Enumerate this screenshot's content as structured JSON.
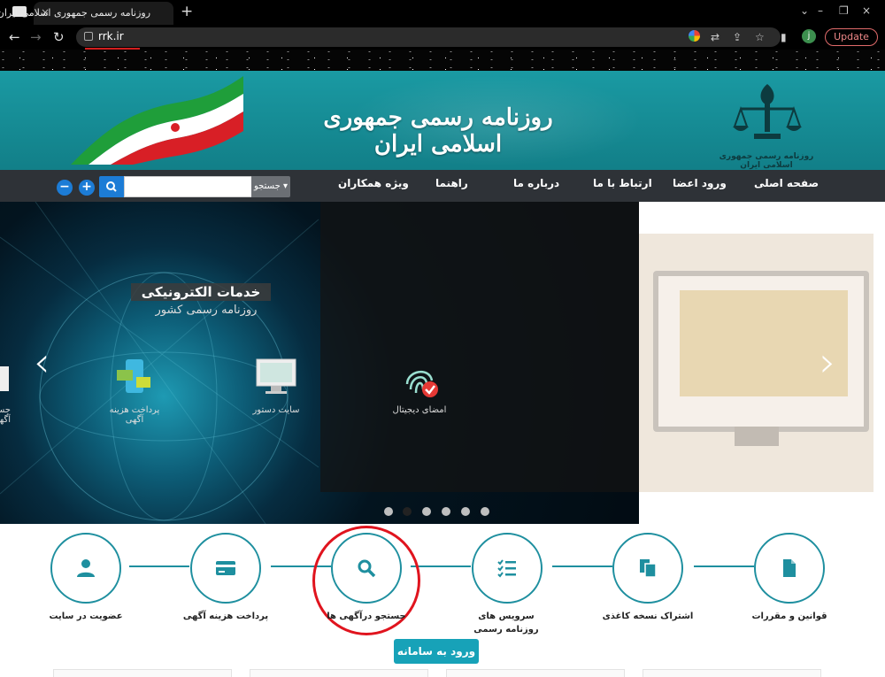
{
  "browser": {
    "tab_title": "روزنامه رسمی جمهوری اسلامی ایران",
    "tab_close": "×",
    "new_tab": "+",
    "url": "rrk.ir",
    "update_label": "Update",
    "profile_initial": "j",
    "nav": {
      "back": "←",
      "forward": "→",
      "reload": "↻"
    },
    "window": {
      "minimize": "–",
      "restore": "❐",
      "close": "×",
      "chevron": "⌄"
    },
    "tools": {
      "translate": "⇄",
      "share": "⇪",
      "bookmark": "☆",
      "sidepanel": "▮"
    }
  },
  "header": {
    "title": "روزنامه رسمی جمهوری اسلامی ایران",
    "emblem_text": "روزنامه رسمی جمهوری اسلامی ایران"
  },
  "nav": {
    "items": [
      "صفحه اصلی",
      "ورود اعضا",
      "ارتباط با ما",
      "درباره ما",
      "راهنما",
      "ویژه همکاران"
    ],
    "search_button": "جستجو",
    "search_value": "",
    "zoom_in": "+",
    "zoom_out": "−"
  },
  "hero": {
    "heading": "خدمات الکترونیکی",
    "subheading": "روزنامه رسمی کشور",
    "services": [
      {
        "label": "امضای دیجیتال",
        "icon": "fingerprint-icon"
      },
      {
        "label": "سایت دستور",
        "icon": "monitor-icon"
      },
      {
        "label": "پرداخت هزینه آگهی",
        "icon": "phone-payment-icon"
      },
      {
        "label": "جستجو آگهی",
        "icon": "search-doc-icon"
      }
    ],
    "prev_arrow": "‹",
    "next_arrow": "›",
    "slide_count": 6,
    "active_slide": 2
  },
  "quick_links": [
    {
      "label": "قوانین و مقررات",
      "icon": "document-icon"
    },
    {
      "label": "اشتراک نسخه کاغذی",
      "icon": "copy-icon"
    },
    {
      "label": "سرویس های روزنامه رسمی",
      "icon": "checklist-icon"
    },
    {
      "label": "جستجو درآگهی ها",
      "icon": "search-icon"
    },
    {
      "label": "پرداخت هزینه آگهی",
      "icon": "credit-card-icon"
    },
    {
      "label": "عضویت در سایت",
      "icon": "user-icon"
    }
  ],
  "enter_button": "ورود به سامانه",
  "colors": {
    "teal": "#1e8f9f",
    "nav_bg": "#2e3237",
    "button_teal": "#17a2b8",
    "search_blue": "#1c7cd6",
    "highlight_red": "#e0141e"
  }
}
